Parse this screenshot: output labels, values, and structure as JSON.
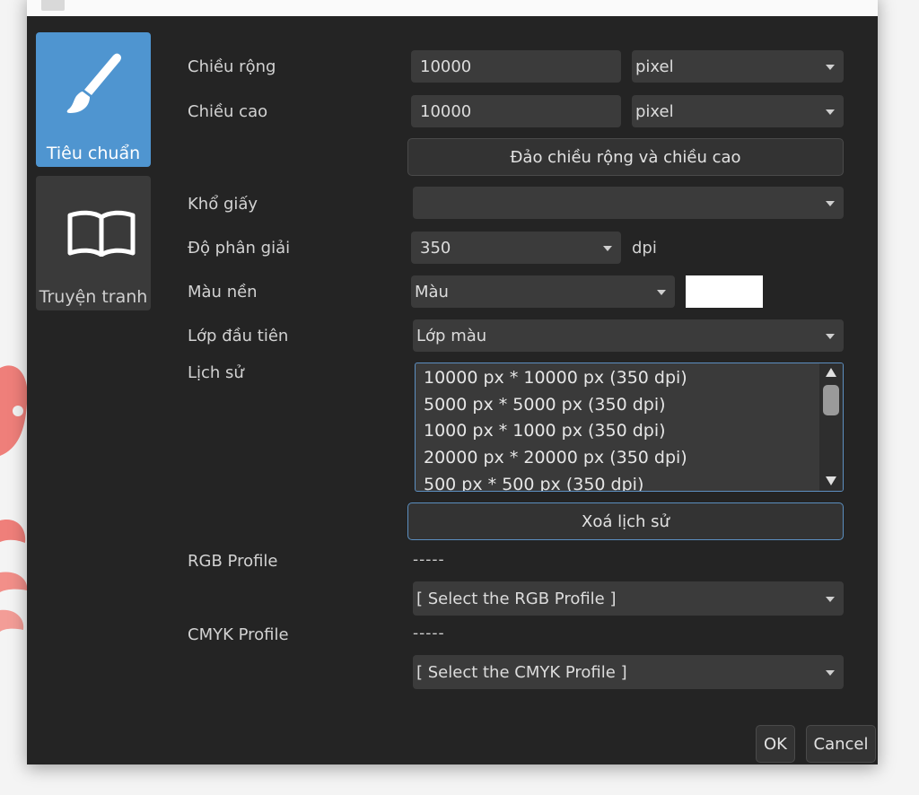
{
  "sidebar": {
    "items": [
      {
        "label": "Tiêu chuẩn",
        "icon": "brush-icon",
        "active": true
      },
      {
        "label": "Truyện tranh",
        "icon": "open-book-icon",
        "active": false
      }
    ]
  },
  "form": {
    "width_label": "Chiều rộng",
    "width_value": "10000",
    "width_unit": "pixel",
    "height_label": "Chiều cao",
    "height_value": "10000",
    "height_unit": "pixel",
    "swap_button": "Đảo chiều rộng và chiều cao",
    "paper_label": "Khổ giấy",
    "paper_value": "",
    "resolution_label": "Độ phân giải",
    "resolution_value": "350",
    "resolution_unit": "dpi",
    "bg_label": "Màu nền",
    "bg_value": "Màu",
    "bg_color": "#ffffff",
    "layer_label": "Lớp đầu tiên",
    "layer_value": "Lớp màu",
    "history_label": "Lịch sử",
    "history_items": [
      "10000 px * 10000 px (350 dpi)",
      "5000 px * 5000 px (350 dpi)",
      "1000 px * 1000 px (350 dpi)",
      "20000 px * 20000 px (350 dpi)",
      "500 px * 500 px (350 dpi)"
    ],
    "clear_history_button": "Xoá lịch sử",
    "rgb_label": "RGB Profile",
    "rgb_current": "-----",
    "rgb_select": "[ Select the RGB Profile ]",
    "cmyk_label": "CMYK Profile",
    "cmyk_current": "-----",
    "cmyk_select": "[ Select the CMYK Profile ]"
  },
  "footer": {
    "ok": "OK",
    "cancel": "Cancel"
  },
  "colors": {
    "dialog_bg": "#242424",
    "active_tab": "#4f95d0",
    "inactive_tab": "#3a3a3a",
    "focus_border": "#5b8fc0"
  }
}
